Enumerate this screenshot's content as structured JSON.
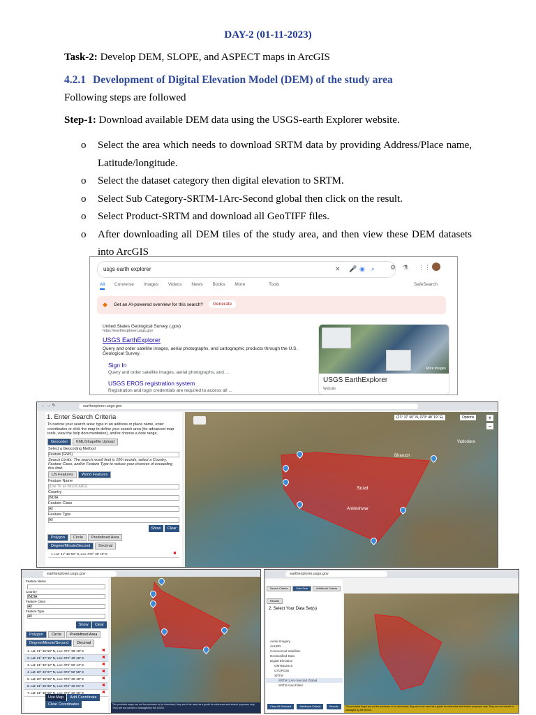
{
  "heading": "DAY-2 (01-11-2023)",
  "task": {
    "label": "Task-2:",
    "text": " Develop DEM, SLOPE, and ASPECT maps in ArcGIS"
  },
  "section": {
    "number": "4.2.1",
    "title": "Development of Digital Elevation Model (DEM) of the study area"
  },
  "following": "Following steps are followed",
  "step1": {
    "label": "Step-1:",
    "text": " Download available DEM data using the USGS-earth Explorer website."
  },
  "bullets": [
    "Select the area which needs to download SRTM data by providing Address/Place name, Latitude/longitude.",
    "Select the dataset category then digital elevation to SRTM.",
    "Select Sub Category-SRTM-1Arc-Second global then click on the result.",
    "Select Product-SRTM and download all GeoTIFF files.",
    "After downloading all DEM tiles of the study area, and then view these DEM datasets into ArcGIS"
  ],
  "bullet_marker": "o",
  "shot1": {
    "query": "usgs earth explorer",
    "tabs": [
      "All",
      "Converse",
      "Images",
      "Videos",
      "News",
      "Books",
      "More",
      "Tools"
    ],
    "safesearch": "SafeSearch",
    "ai_prompt": "Get an AI-powered overview for this search?",
    "ai_button": "Generate",
    "source": "United States Geological Survey (.gov)",
    "source_url": "https://earthexplorer.usgs.gov",
    "result_title": "USGS EarthExplorer",
    "result_desc": "Query and order satellite images, aerial photographs, and cartographic products through the U.S. Geological Survey.",
    "sub1_title": "Sign In",
    "sub1_desc": "Query and order satellite images, aerial photographs, and ...",
    "sub2_title": "USGS EROS registration system",
    "sub2_desc": "Registration and login credentials are required to access all ...",
    "kp_title": "USGS EarthExplorer",
    "kp_sub": "Website",
    "kp_more": "More images"
  },
  "shot2": {
    "url": "earthexplorer.usgs.gov",
    "panel_title": "1. Enter Search Criteria",
    "intro": "To narrow your search area: type in an address or place name, enter coordinates or click the map to define your search area (for advanced map tools, view the help documentation), and/or choose a date range.",
    "tabs": [
      "Geocoder",
      "KML/Shapefile Upload"
    ],
    "method_label": "Select a Geocoding Method",
    "method_value": "Feature (GNIS)",
    "limits": "Search Limits: The search result limit is 100 records; select a Country, Feature Class, and/or Feature Type to reduce your chances of exceeding this limit.",
    "feature_tabs": [
      "US Features",
      "World Features"
    ],
    "feature_name_label": "Feature Name",
    "feature_name_ph": "(Use '%' as WILDCARD)",
    "country_label": "Country",
    "country_value": "INDIA",
    "class_label": "Feature Class",
    "class_value": "All",
    "type_label": "Feature Type",
    "type_value": "All",
    "show": "Show",
    "clear": "Clear",
    "shape_tabs": [
      "Polygon",
      "Circle",
      "Predefined Area"
    ],
    "coord_tabs": [
      "Degree/Minute/Second",
      "Decimal"
    ],
    "coord1": "1.  Lat: 21° 36' 59\" N, Lon: 072° 38' 19\" E",
    "map_coord": "(21° 37' 60\" N, 073° 48' 19\" E)",
    "options": "Options",
    "map_labels": [
      "Surat",
      "Bharuch",
      "Vadodara",
      "Ankleshwar"
    ]
  },
  "shot3": {
    "coords": [
      "1.  Lat: 21° 36' 59\" N, Lon: 072° 38' 19\" E",
      "2.  Lat: 21° 37' 15\" N, Lon: 072° 40' 46\" E",
      "3.  Lat: 21° 30' 12\" N, Lon: 072° 50' 14\" E",
      "4.  Lat: 20° 43' 07\" N, Lon: 072° 52' 56\" E",
      "5.  Lat: 20° 38' 60\" N, Lon: 072° 39' 49\" E",
      "6.  Lat: 21° 55' 60\" N, Lon: 072° 32' 01\" E",
      "7.  Lat: 21° 38' 08\" N, Lon: 072° 32' 36\" E"
    ],
    "buttons": [
      "Use Map",
      "Add Coordinate",
      "Clear Coordinates"
    ],
    "disclaimer": "The provided maps are not for purchase or for download; they are to be used as a guide for reference and search purposes only. They are not owned or managed by the USGS."
  },
  "shot4": {
    "tabs": [
      "Search Criteria",
      "Data Sets",
      "Additional Criteria",
      "Results"
    ],
    "panel_title": "2. Select Your Data Set(s)",
    "tree": [
      "Aerial Imagery",
      "AVHRR",
      "Commercial Satellites",
      "Declassified Data",
      "Digital Elevation",
      "GMTED2010",
      "GTOPO30",
      "SRTM",
      "SRTM 1 Arc-Second Global",
      "SRTM Void Filled"
    ],
    "footer_buttons": [
      "Clear All Selected",
      "Additional Criteria",
      "Results"
    ]
  }
}
